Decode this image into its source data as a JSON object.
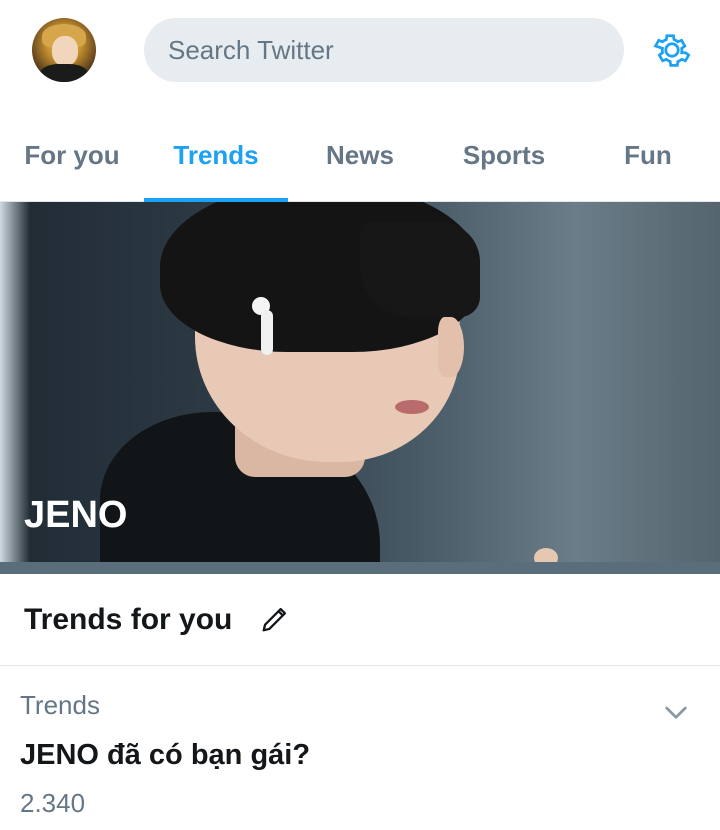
{
  "header": {
    "search_placeholder": "Search Twitter",
    "avatar_icon": "user-avatar",
    "settings_icon": "gear-icon",
    "accent_color": "#1da1f2"
  },
  "tabs": [
    {
      "label": "For you",
      "active": false
    },
    {
      "label": "Trends",
      "active": true
    },
    {
      "label": "News",
      "active": false
    },
    {
      "label": "Sports",
      "active": false
    },
    {
      "label": "Fun",
      "active": false
    }
  ],
  "hero": {
    "title": "JENO"
  },
  "trends_section": {
    "title": "Trends for you",
    "edit_icon": "pencil-icon"
  },
  "trend_item": {
    "category": "Trends",
    "name": "JENO đã có bạn gái?",
    "count": "2.340",
    "menu_icon": "chevron-down-icon"
  }
}
